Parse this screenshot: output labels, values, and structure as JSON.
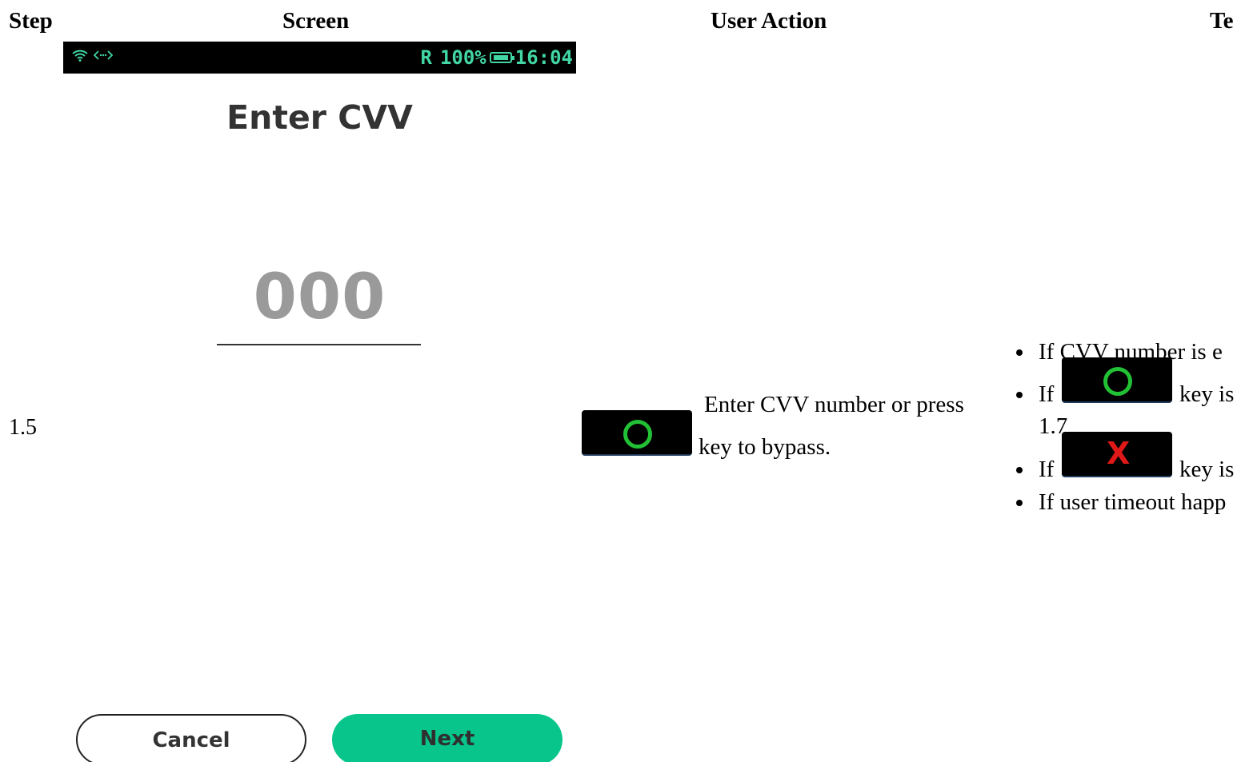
{
  "table": {
    "headers": {
      "step": "Step",
      "screen": "Screen",
      "user_action": "User Action",
      "test_result": "Te"
    },
    "row": {
      "step": "1.5",
      "screen": {
        "status": {
          "icons": [
            "wifi-icon",
            "connection-arrows-icon",
            "battery-icon"
          ],
          "carrier": "R",
          "battery_pct": "100%",
          "time": "16:04",
          "accent_color": "#42d6a4"
        },
        "title": "Enter CVV",
        "cvv_value": "000",
        "cancel_label": "Cancel",
        "next_label": "Next",
        "next_color": "#08c68b"
      },
      "user_action": {
        "text_before": "Enter CVV number or press",
        "text_after": "key to bypass.",
        "key_icon": "ok-key-icon"
      },
      "test_results": [
        {
          "prefix": "If CVV number is e"
        },
        {
          "prefix": "If",
          "key_icon": "ok-key-icon",
          "suffix": "key is",
          "cont": "1.7"
        },
        {
          "prefix": "If",
          "key_icon": "cancel-key-icon",
          "suffix": "key is"
        },
        {
          "prefix": "If user timeout happ"
        }
      ]
    }
  }
}
